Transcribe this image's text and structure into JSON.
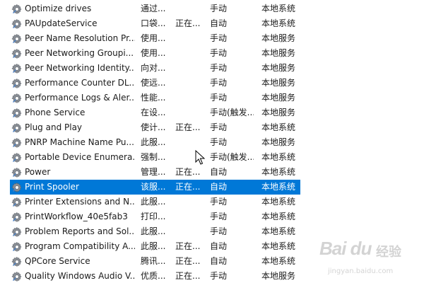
{
  "services": [
    {
      "name": "Optimize drives",
      "description": "通过...",
      "status": "",
      "startup_type": "手动",
      "log_on_as": "本地系统"
    },
    {
      "name": "PAUpdateService",
      "description": "口袋...",
      "status": "正在...",
      "startup_type": "自动",
      "log_on_as": "本地系统"
    },
    {
      "name": "Peer Name Resolution Pr...",
      "description": "使用...",
      "status": "",
      "startup_type": "手动",
      "log_on_as": "本地服务"
    },
    {
      "name": "Peer Networking Groupi...",
      "description": "使用...",
      "status": "",
      "startup_type": "手动",
      "log_on_as": "本地服务"
    },
    {
      "name": "Peer Networking Identity...",
      "description": "向对...",
      "status": "",
      "startup_type": "手动",
      "log_on_as": "本地服务"
    },
    {
      "name": "Performance Counter DL...",
      "description": "使远...",
      "status": "",
      "startup_type": "手动",
      "log_on_as": "本地服务"
    },
    {
      "name": "Performance Logs & Aler...",
      "description": "性能...",
      "status": "",
      "startup_type": "手动",
      "log_on_as": "本地服务"
    },
    {
      "name": "Phone Service",
      "description": "在设...",
      "status": "",
      "startup_type": "手动(触发...",
      "log_on_as": "本地服务"
    },
    {
      "name": "Plug and Play",
      "description": "使计...",
      "status": "正在...",
      "startup_type": "手动",
      "log_on_as": "本地系统"
    },
    {
      "name": "PNRP Machine Name Pu...",
      "description": "此服...",
      "status": "",
      "startup_type": "手动",
      "log_on_as": "本地服务"
    },
    {
      "name": "Portable Device Enumera...",
      "description": "强制...",
      "status": "",
      "startup_type": "手动(触发...",
      "log_on_as": "本地系统"
    },
    {
      "name": "Power",
      "description": "管理...",
      "status": "正在...",
      "startup_type": "自动",
      "log_on_as": "本地系统"
    },
    {
      "name": "Print Spooler",
      "description": "该服...",
      "status": "正在...",
      "startup_type": "自动",
      "log_on_as": "本地系统"
    },
    {
      "name": "Printer Extensions and N...",
      "description": "此服...",
      "status": "",
      "startup_type": "手动",
      "log_on_as": "本地系统"
    },
    {
      "name": "PrintWorkflow_40e5fab3",
      "description": "打印...",
      "status": "",
      "startup_type": "手动",
      "log_on_as": "本地系统"
    },
    {
      "name": "Problem Reports and Sol...",
      "description": "此服...",
      "status": "",
      "startup_type": "手动",
      "log_on_as": "本地系统"
    },
    {
      "name": "Program Compatibility A...",
      "description": "此服...",
      "status": "正在...",
      "startup_type": "自动",
      "log_on_as": "本地系统"
    },
    {
      "name": "QPCore Service",
      "description": "腾讯...",
      "status": "正在...",
      "startup_type": "自动",
      "log_on_as": "本地系统"
    },
    {
      "name": "Quality Windows Audio V...",
      "description": "优质...",
      "status": "正在...",
      "startup_type": "手动",
      "log_on_as": "本地服务"
    }
  ],
  "selected_service": "Print Spooler",
  "watermark": {
    "logo": "Bai du",
    "sub": "经验",
    "url": "jingyan.baidu.com"
  },
  "icon": "gear-icon",
  "colors": {
    "selection": "#0078d7",
    "selection_text": "#ffffff"
  }
}
